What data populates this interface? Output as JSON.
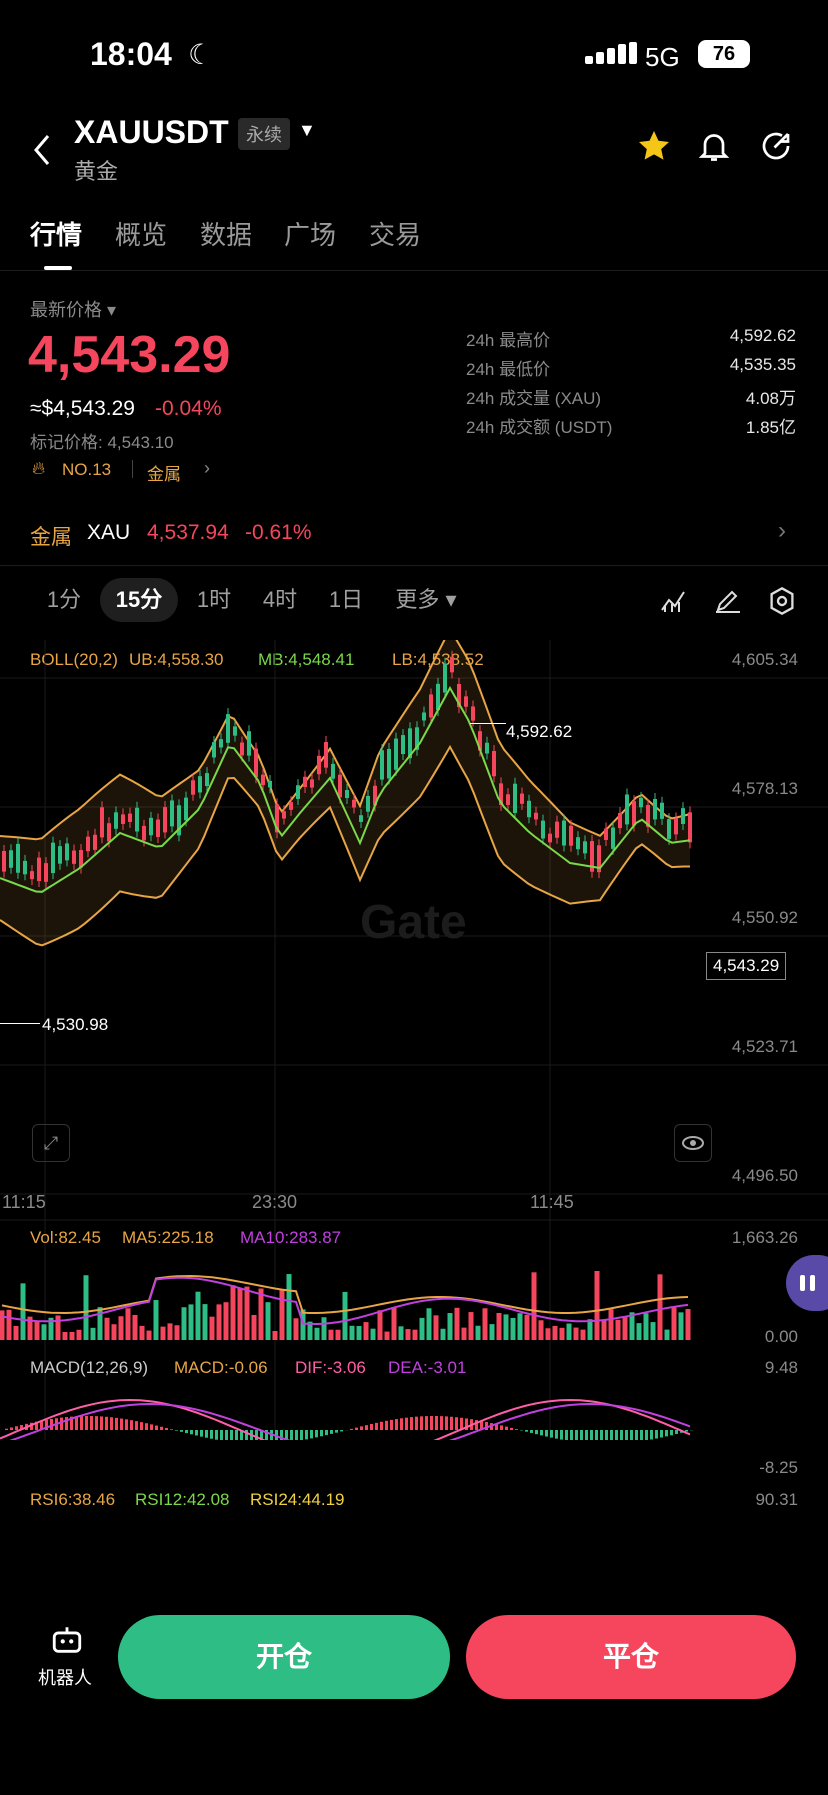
{
  "status": {
    "time": "18:04",
    "network": "5G",
    "battery": "76"
  },
  "header": {
    "symbol": "XAUUSDT",
    "badge": "永续",
    "subtitle": "黄金"
  },
  "tabs": [
    "行情",
    "概览",
    "数据",
    "广场",
    "交易"
  ],
  "price": {
    "label": "最新价格",
    "last": "4,543.29",
    "usd": "≈$4,543.29",
    "change": "-0.04%",
    "mark": "标记价格: 4,543.10",
    "rank": "NO.13",
    "category": "金属"
  },
  "stats": [
    {
      "label": "24h 最高价",
      "value": "4,592.62"
    },
    {
      "label": "24h 最低价",
      "value": "4,535.35"
    },
    {
      "label": "24h 成交量 (XAU)",
      "value": "4.08万"
    },
    {
      "label": "24h 成交额 (USDT)",
      "value": "1.85亿"
    }
  ],
  "related": {
    "label": "金属",
    "symbol": "XAU",
    "price": "4,537.94",
    "change": "-0.61%"
  },
  "timeframes": [
    "1分",
    "15分",
    "1时",
    "4时",
    "1日",
    "更多"
  ],
  "boll": {
    "name": "BOLL(20,2)",
    "ub": "UB:4,558.30",
    "mb": "MB:4,548.41",
    "lb": "LB:4,538.52"
  },
  "price_axis": [
    "4,605.34",
    "4,578.13",
    "4,550.92",
    "4,523.71",
    "4,496.50"
  ],
  "chart_markers": {
    "high": "4,592.62",
    "low": "4,530.98",
    "current": "4,543.29"
  },
  "time_axis": [
    "11:15",
    "23:30",
    "11:45"
  ],
  "volume": {
    "vol": "Vol:82.45",
    "ma5": "MA5:225.18",
    "ma10": "MA10:283.87",
    "max": "1,663.26",
    "min": "0.00"
  },
  "macd": {
    "name": "MACD(12,26,9)",
    "macd": "MACD:-0.06",
    "dif": "DIF:-3.06",
    "dea": "DEA:-3.01",
    "max": "9.48",
    "min": "-8.25"
  },
  "rsi": {
    "rsi6": "RSI6:38.46",
    "rsi12": "RSI12:42.08",
    "rsi24": "RSI24:44.19",
    "max": "90.31"
  },
  "bottom": {
    "robot": "机器人",
    "open": "开仓",
    "close": "平仓"
  },
  "colors": {
    "up": "#2ebd85",
    "down": "#f6465d",
    "boll": "#e8a545",
    "mid": "#7ad84a"
  }
}
